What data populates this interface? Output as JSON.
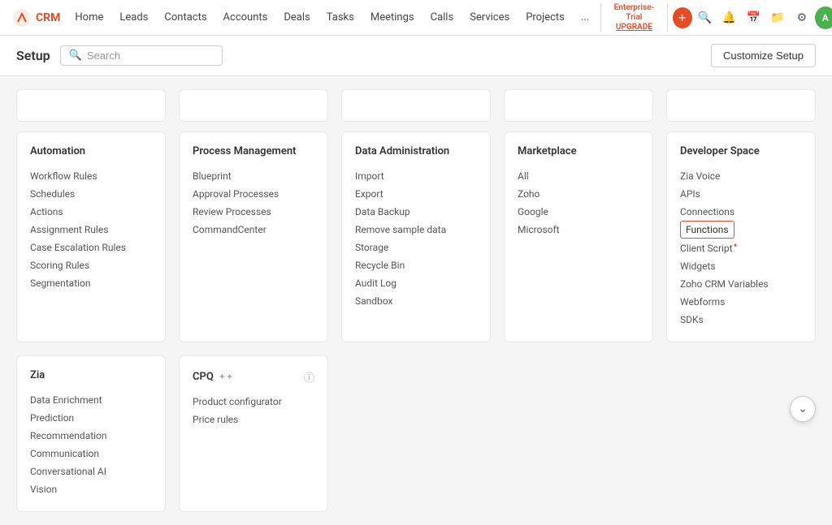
{
  "topnav": {
    "logo_text": "CRM",
    "items": [
      "Home",
      "Leads",
      "Contacts",
      "Accounts",
      "Deals",
      "Tasks",
      "Meetings",
      "Calls",
      "Services",
      "Projects",
      "..."
    ],
    "enterprise_label": "Enterprise-Trial",
    "upgrade_label": "UPGRADE",
    "add_btn": "+",
    "avatar_letter": "A",
    "customize_btn": "Customize Setup"
  },
  "setup": {
    "title": "Setup",
    "search_placeholder": "Search"
  },
  "cards": {
    "automation": {
      "title": "Automation",
      "items": [
        "Workflow Rules",
        "Schedules",
        "Actions",
        "Assignment Rules",
        "Case Escalation Rules",
        "Scoring Rules",
        "Segmentation"
      ]
    },
    "process_management": {
      "title": "Process Management",
      "items": [
        "Blueprint",
        "Approval Processes",
        "Review Processes",
        "CommandCenter"
      ]
    },
    "data_administration": {
      "title": "Data Administration",
      "items": [
        "Import",
        "Export",
        "Data Backup",
        "Remove sample data",
        "Storage",
        "Recycle Bin",
        "Audit Log",
        "Sandbox"
      ]
    },
    "marketplace": {
      "title": "Marketplace",
      "items": [
        "All",
        "Zoho",
        "Google",
        "Microsoft"
      ]
    },
    "developer_space": {
      "title": "Developer Space",
      "items": [
        "Zia Voice",
        "APIs",
        "Connections",
        "Functions",
        "Client Script",
        "Widgets",
        "Zoho CRM Variables",
        "Webforms",
        "SDKs"
      ],
      "highlighted_item": "Functions",
      "client_script_superscript": "✦"
    }
  },
  "bottom_cards": {
    "zia": {
      "title": "Zia",
      "items": [
        "Data Enrichment",
        "Prediction",
        "Recommendation",
        "Communication",
        "Conversational AI",
        "Vision"
      ]
    },
    "cpq": {
      "title": "CPQ",
      "items": [
        "Product configurator",
        "Price rules"
      ]
    }
  }
}
